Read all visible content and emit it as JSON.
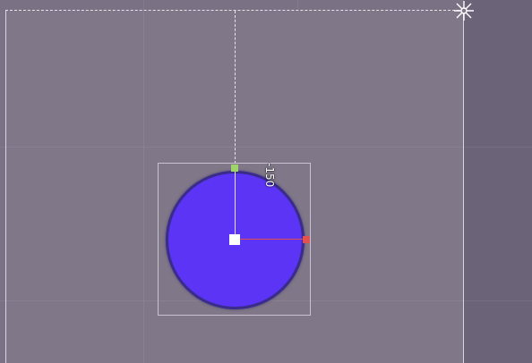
{
  "editor": {
    "rotation_readout": "-150",
    "icons": {
      "pivot": "pivot-star-icon",
      "origin": "origin-handle",
      "rotation": "rotation-handle",
      "x_axis": "x-axis-handle"
    }
  },
  "sprite": {
    "shape": "circle",
    "fill_color": "#5b34f5",
    "outline_color": "#3a2c8a"
  },
  "colors": {
    "canvas": "#807889",
    "outside": "#6b6377",
    "x_axis": "#e24c4c",
    "rotation_handle": "#9fd46a",
    "origin_handle": "#ffffff"
  }
}
